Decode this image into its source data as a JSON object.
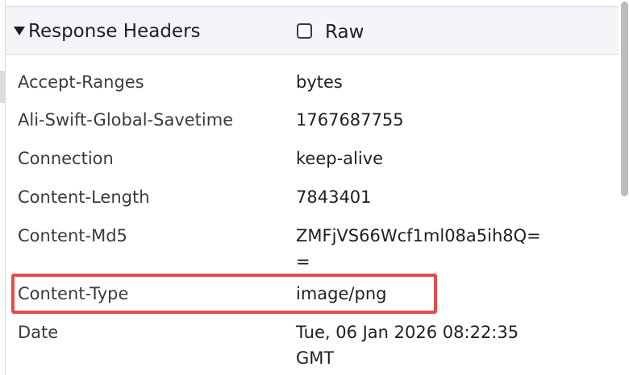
{
  "section": {
    "title": "Response Headers",
    "raw_label": "Raw",
    "raw_checked": false
  },
  "headers": [
    {
      "name": "Accept-Ranges",
      "value": "bytes"
    },
    {
      "name": "Ali-Swift-Global-Savetime",
      "value": "1767687755"
    },
    {
      "name": "Connection",
      "value": "keep-alive"
    },
    {
      "name": "Content-Length",
      "value": "7843401"
    },
    {
      "name": "Content-Md5",
      "value": "ZMFjVS66Wcf1ml08a5ih8Q=="
    },
    {
      "name": "Content-Type",
      "value": "image/png"
    },
    {
      "name": "Date",
      "value": "Tue, 06 Jan 2026 08:22:35 GMT"
    }
  ],
  "colors": {
    "highlight": "#e54b4b",
    "header_bg": "#f3f5f9",
    "scrollbar": "#bdbdbd"
  }
}
